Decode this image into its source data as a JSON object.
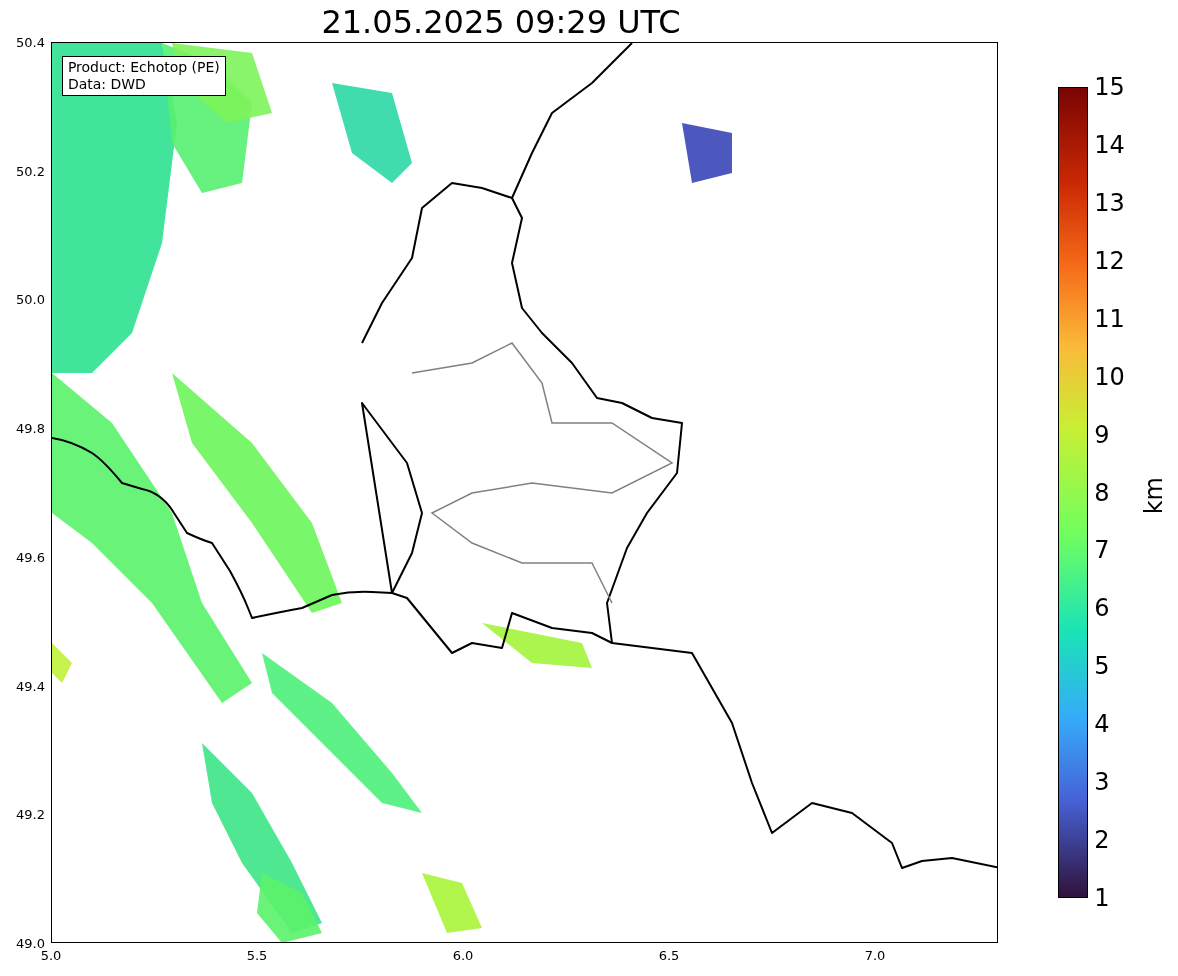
{
  "title": "21.05.2025 09:29 UTC",
  "legend": [
    "Product: Echotop (PE)",
    "Data: DWD"
  ],
  "x_axis": {
    "ticks": [
      "5.0",
      "5.5",
      "6.0",
      "6.5",
      "7.0"
    ]
  },
  "y_axis": {
    "ticks": [
      "50.4",
      "50.2",
      "50.0",
      "49.8",
      "49.6",
      "49.4",
      "49.2",
      "49.0"
    ]
  },
  "colorbar": {
    "label": "km",
    "ticks": [
      "15",
      "14",
      "13",
      "12",
      "11",
      "10",
      "9",
      "8",
      "7",
      "6",
      "5",
      "4",
      "3",
      "2",
      "1"
    ]
  }
}
